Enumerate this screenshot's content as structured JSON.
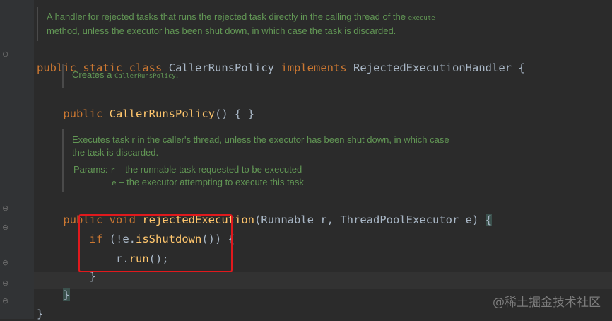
{
  "doc1": {
    "line1": "A handler for rejected tasks that runs the rejected task directly in the calling thread of the",
    "line1_code": "execute",
    "line2": "method, unless the executor has been shut down, in which case the task is discarded."
  },
  "class_decl": {
    "kw1": "public",
    "kw2": "static",
    "kw3": "class",
    "name": "CallerRunsPolicy",
    "kw4": "implements",
    "iface": "RejectedExecutionHandler",
    "brace": "{"
  },
  "doc2": {
    "text": "Creates a",
    "code": "CallerRunsPolicy",
    "end": "."
  },
  "ctor": {
    "kw": "public",
    "name": "CallerRunsPolicy",
    "parens": "()",
    "body": "{ }"
  },
  "doc3": {
    "line1": "Executes task r in the caller's thread, unless the executor has been shut down, in which case",
    "line2": "the task is discarded.",
    "params_label": "Params:",
    "p1_name": "r",
    "p1_desc": "– the runnable task requested to be executed",
    "p2_name": "e",
    "p2_desc": "– the executor attempting to execute this task"
  },
  "method": {
    "kw1": "public",
    "kw2": "void",
    "name": "rejectedExecution",
    "open": "(",
    "t1": "Runnable",
    "p1": "r,",
    "t2": "ThreadPoolExecutor",
    "p2": "e)",
    "brace": "{"
  },
  "body": {
    "if_kw": "if",
    "cond_open": "(!e.",
    "cond_call": "isShutdown",
    "cond_close": "())",
    "if_brace": "{",
    "run_obj": "r.",
    "run_call": "run",
    "run_end": "();",
    "if_close": "}",
    "method_close": "}",
    "class_close": "}"
  },
  "watermark": "@稀土掘金技术社区",
  "colors": {
    "background": "#2b2b2b",
    "keyword": "#cc7832",
    "method": "#ffc66d",
    "doc": "#629755",
    "highlight_box": "#e0191d"
  }
}
